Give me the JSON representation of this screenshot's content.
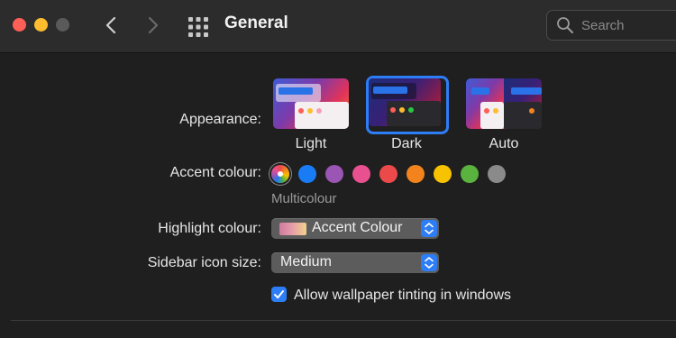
{
  "window": {
    "title": "General",
    "search_placeholder": "Search"
  },
  "toolbar_icons": [
    "close-control",
    "minimize-control",
    "zoom-control",
    "back-chevron-icon",
    "forward-chevron-icon",
    "grid-icon",
    "search-icon"
  ],
  "appearance": {
    "label": "Appearance:",
    "options": [
      "Light",
      "Dark",
      "Auto"
    ],
    "selected": "Dark"
  },
  "accent": {
    "label": "Accent colour:",
    "colors": [
      "multicolour",
      "#1a7cf5",
      "#9a55b5",
      "#e9508f",
      "#ec4a4a",
      "#f3841d",
      "#f7c200",
      "#5ab23f",
      "#8a8a8a"
    ],
    "selected_caption": "Multicolour"
  },
  "highlight": {
    "label": "Highlight colour:",
    "value": "Accent Colour"
  },
  "sidebar": {
    "label": "Sidebar icon size:",
    "value": "Medium"
  },
  "tinting": {
    "label": "Allow wallpaper tinting in windows",
    "checked": true
  },
  "colors": {
    "accent_blue": "#2d7df6",
    "window_bg": "#1f1f1f",
    "titlebar_bg": "#2c2c2c"
  }
}
